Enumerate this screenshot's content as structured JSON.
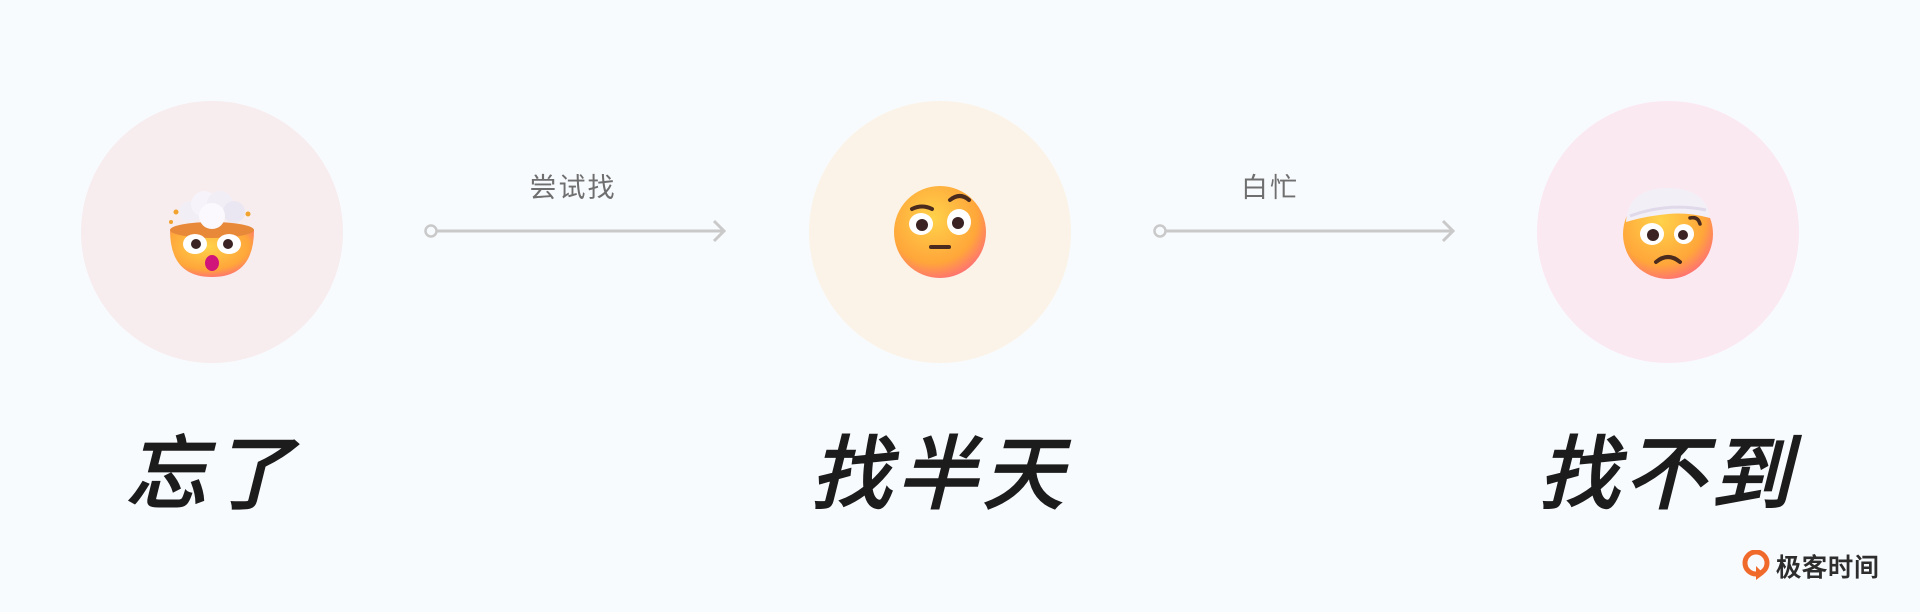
{
  "steps": [
    {
      "label": "忘了",
      "icon": "exploding-head-icon",
      "bg": "#f7ecee"
    },
    {
      "label": "找半天",
      "icon": "raised-eyebrow-face-icon",
      "bg": "#fbf3e8"
    },
    {
      "label": "找不到",
      "icon": "bandaged-head-face-icon",
      "bg": "#fbe9f2"
    }
  ],
  "transitions": [
    {
      "label": "尝试找"
    },
    {
      "label": "白忙"
    }
  ],
  "brand": {
    "name": "极客时间",
    "color": "#f06a2c"
  },
  "colors": {
    "arrow": "#c9c9c9",
    "face": "#ffb52e",
    "text": "#1c1c1c"
  }
}
